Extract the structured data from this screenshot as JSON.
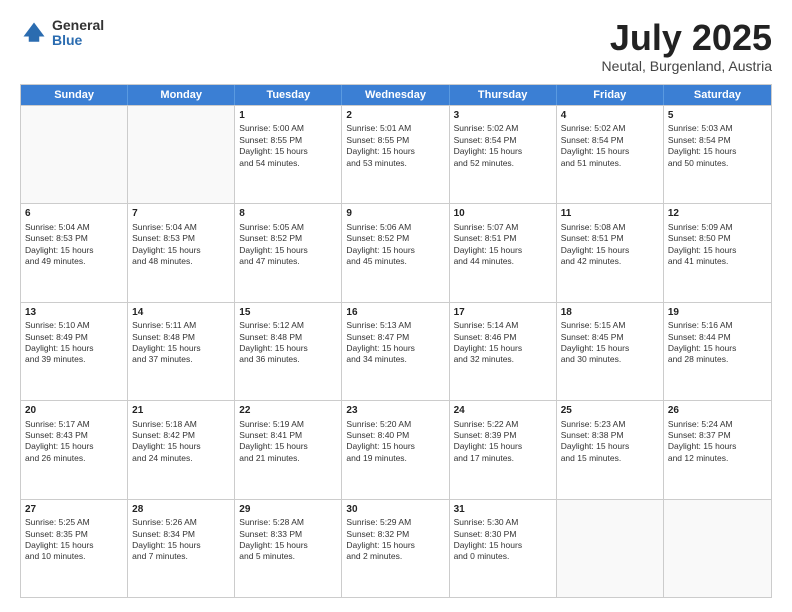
{
  "logo": {
    "general": "General",
    "blue": "Blue"
  },
  "header": {
    "month": "July 2025",
    "location": "Neutal, Burgenland, Austria"
  },
  "days": [
    "Sunday",
    "Monday",
    "Tuesday",
    "Wednesday",
    "Thursday",
    "Friday",
    "Saturday"
  ],
  "weeks": [
    [
      {
        "day": "",
        "content": ""
      },
      {
        "day": "",
        "content": ""
      },
      {
        "day": "1",
        "content": "Sunrise: 5:00 AM\nSunset: 8:55 PM\nDaylight: 15 hours\nand 54 minutes."
      },
      {
        "day": "2",
        "content": "Sunrise: 5:01 AM\nSunset: 8:55 PM\nDaylight: 15 hours\nand 53 minutes."
      },
      {
        "day": "3",
        "content": "Sunrise: 5:02 AM\nSunset: 8:54 PM\nDaylight: 15 hours\nand 52 minutes."
      },
      {
        "day": "4",
        "content": "Sunrise: 5:02 AM\nSunset: 8:54 PM\nDaylight: 15 hours\nand 51 minutes."
      },
      {
        "day": "5",
        "content": "Sunrise: 5:03 AM\nSunset: 8:54 PM\nDaylight: 15 hours\nand 50 minutes."
      }
    ],
    [
      {
        "day": "6",
        "content": "Sunrise: 5:04 AM\nSunset: 8:53 PM\nDaylight: 15 hours\nand 49 minutes."
      },
      {
        "day": "7",
        "content": "Sunrise: 5:04 AM\nSunset: 8:53 PM\nDaylight: 15 hours\nand 48 minutes."
      },
      {
        "day": "8",
        "content": "Sunrise: 5:05 AM\nSunset: 8:52 PM\nDaylight: 15 hours\nand 47 minutes."
      },
      {
        "day": "9",
        "content": "Sunrise: 5:06 AM\nSunset: 8:52 PM\nDaylight: 15 hours\nand 45 minutes."
      },
      {
        "day": "10",
        "content": "Sunrise: 5:07 AM\nSunset: 8:51 PM\nDaylight: 15 hours\nand 44 minutes."
      },
      {
        "day": "11",
        "content": "Sunrise: 5:08 AM\nSunset: 8:51 PM\nDaylight: 15 hours\nand 42 minutes."
      },
      {
        "day": "12",
        "content": "Sunrise: 5:09 AM\nSunset: 8:50 PM\nDaylight: 15 hours\nand 41 minutes."
      }
    ],
    [
      {
        "day": "13",
        "content": "Sunrise: 5:10 AM\nSunset: 8:49 PM\nDaylight: 15 hours\nand 39 minutes."
      },
      {
        "day": "14",
        "content": "Sunrise: 5:11 AM\nSunset: 8:48 PM\nDaylight: 15 hours\nand 37 minutes."
      },
      {
        "day": "15",
        "content": "Sunrise: 5:12 AM\nSunset: 8:48 PM\nDaylight: 15 hours\nand 36 minutes."
      },
      {
        "day": "16",
        "content": "Sunrise: 5:13 AM\nSunset: 8:47 PM\nDaylight: 15 hours\nand 34 minutes."
      },
      {
        "day": "17",
        "content": "Sunrise: 5:14 AM\nSunset: 8:46 PM\nDaylight: 15 hours\nand 32 minutes."
      },
      {
        "day": "18",
        "content": "Sunrise: 5:15 AM\nSunset: 8:45 PM\nDaylight: 15 hours\nand 30 minutes."
      },
      {
        "day": "19",
        "content": "Sunrise: 5:16 AM\nSunset: 8:44 PM\nDaylight: 15 hours\nand 28 minutes."
      }
    ],
    [
      {
        "day": "20",
        "content": "Sunrise: 5:17 AM\nSunset: 8:43 PM\nDaylight: 15 hours\nand 26 minutes."
      },
      {
        "day": "21",
        "content": "Sunrise: 5:18 AM\nSunset: 8:42 PM\nDaylight: 15 hours\nand 24 minutes."
      },
      {
        "day": "22",
        "content": "Sunrise: 5:19 AM\nSunset: 8:41 PM\nDaylight: 15 hours\nand 21 minutes."
      },
      {
        "day": "23",
        "content": "Sunrise: 5:20 AM\nSunset: 8:40 PM\nDaylight: 15 hours\nand 19 minutes."
      },
      {
        "day": "24",
        "content": "Sunrise: 5:22 AM\nSunset: 8:39 PM\nDaylight: 15 hours\nand 17 minutes."
      },
      {
        "day": "25",
        "content": "Sunrise: 5:23 AM\nSunset: 8:38 PM\nDaylight: 15 hours\nand 15 minutes."
      },
      {
        "day": "26",
        "content": "Sunrise: 5:24 AM\nSunset: 8:37 PM\nDaylight: 15 hours\nand 12 minutes."
      }
    ],
    [
      {
        "day": "27",
        "content": "Sunrise: 5:25 AM\nSunset: 8:35 PM\nDaylight: 15 hours\nand 10 minutes."
      },
      {
        "day": "28",
        "content": "Sunrise: 5:26 AM\nSunset: 8:34 PM\nDaylight: 15 hours\nand 7 minutes."
      },
      {
        "day": "29",
        "content": "Sunrise: 5:28 AM\nSunset: 8:33 PM\nDaylight: 15 hours\nand 5 minutes."
      },
      {
        "day": "30",
        "content": "Sunrise: 5:29 AM\nSunset: 8:32 PM\nDaylight: 15 hours\nand 2 minutes."
      },
      {
        "day": "31",
        "content": "Sunrise: 5:30 AM\nSunset: 8:30 PM\nDaylight: 15 hours\nand 0 minutes."
      },
      {
        "day": "",
        "content": ""
      },
      {
        "day": "",
        "content": ""
      }
    ]
  ]
}
